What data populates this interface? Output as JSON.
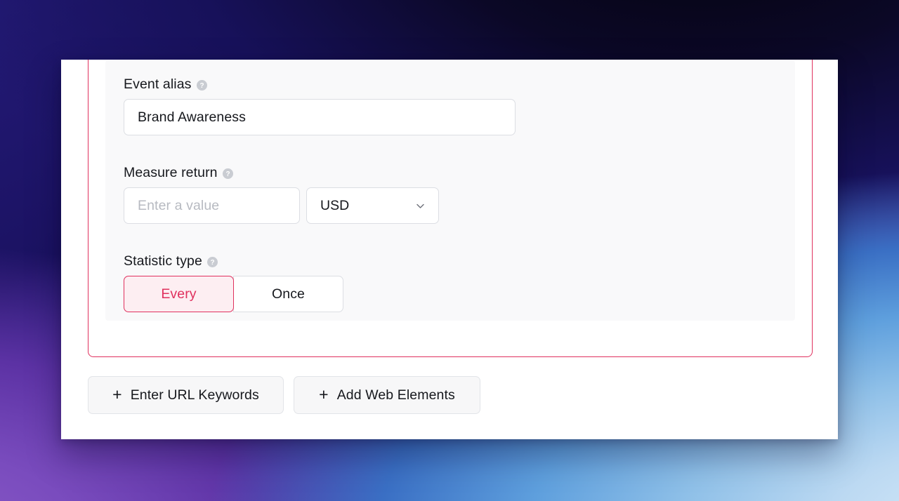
{
  "form": {
    "event_alias": {
      "label": "Event alias",
      "help_icon": "help-circle-icon",
      "value": "Brand Awareness",
      "placeholder": ""
    },
    "measure_return": {
      "label": "Measure return",
      "help_icon": "help-circle-icon",
      "value": "",
      "placeholder": "Enter a value",
      "currency": {
        "selected": "USD",
        "chevron_icon": "chevron-down-icon"
      }
    },
    "statistic_type": {
      "label": "Statistic type",
      "help_icon": "help-circle-icon",
      "options": [
        {
          "label": "Every",
          "selected": true
        },
        {
          "label": "Once",
          "selected": false
        }
      ]
    }
  },
  "actions": {
    "url_keywords": {
      "label": "Enter URL Keywords",
      "icon": "plus-icon",
      "plus": "+"
    },
    "web_elements": {
      "label": "Add Web Elements",
      "icon": "plus-icon",
      "plus": "+"
    }
  },
  "colors": {
    "accent_crimson": "#e0315e",
    "accent_crimson_fill": "#fdeef2",
    "panel_background": "#f9f9fa",
    "window_background": "#ffffff",
    "text_primary": "#16181d",
    "text_placeholder": "#b7bac1",
    "border_neutral": "#dcdee3",
    "help_icon_grey": "#c9ccd2"
  }
}
